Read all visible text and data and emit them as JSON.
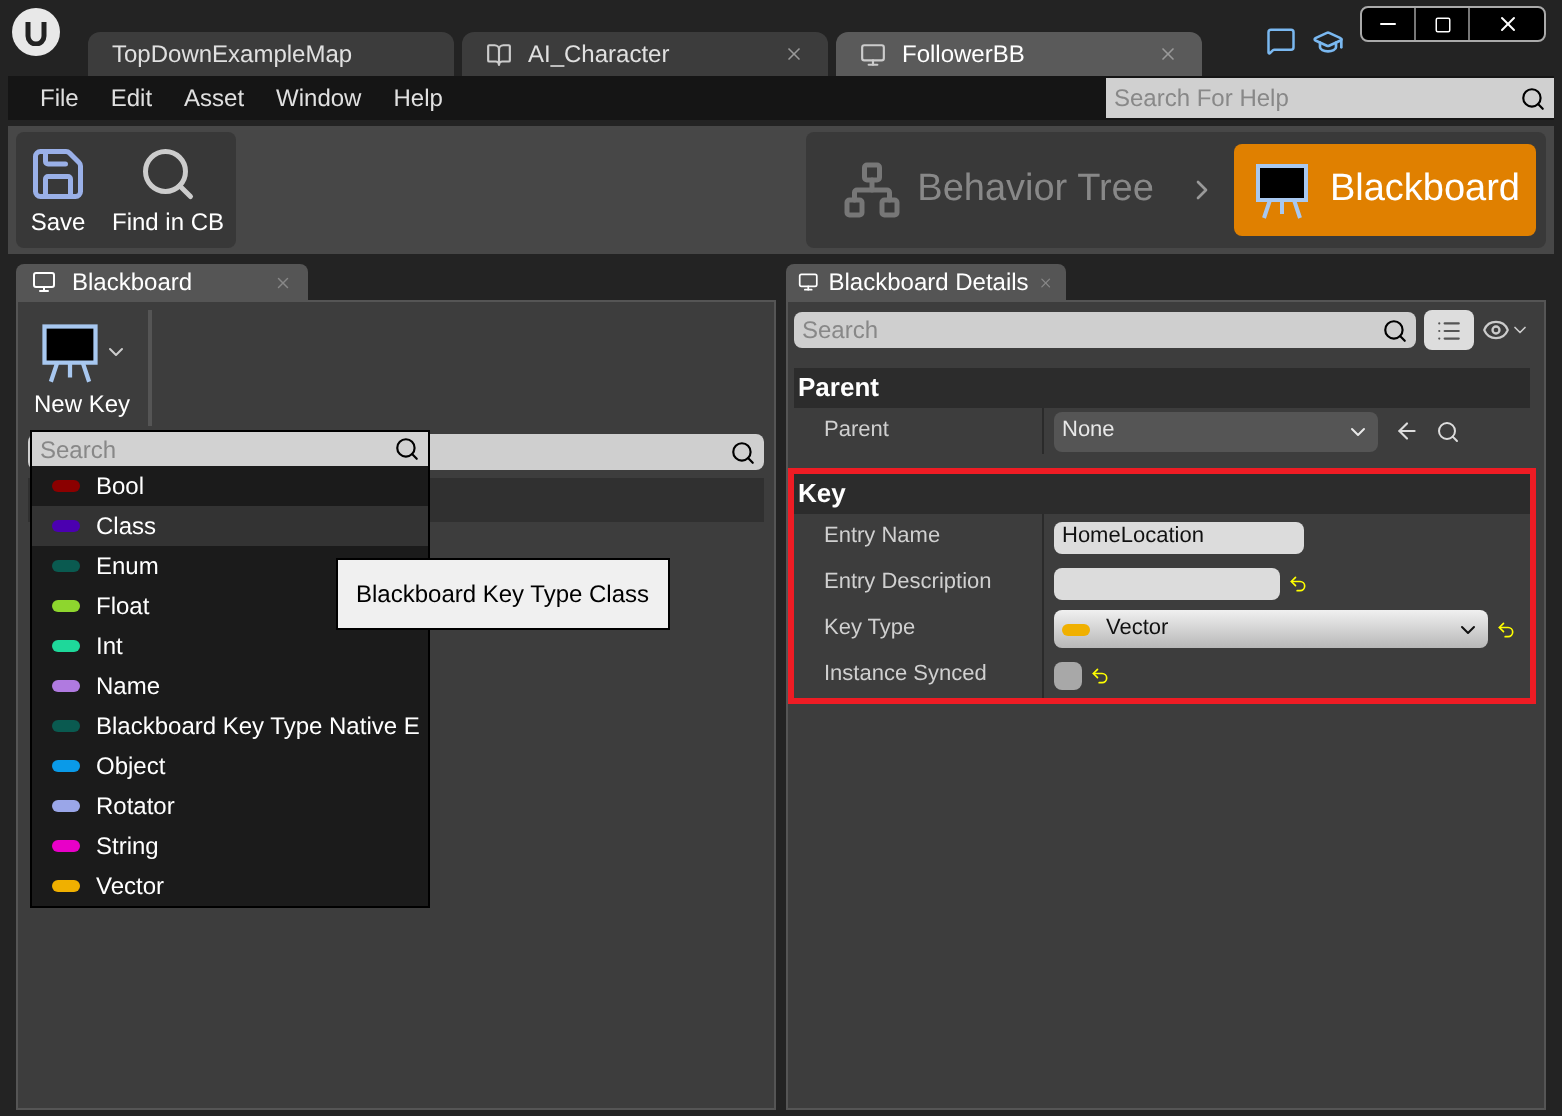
{
  "tabs": [
    {
      "label": "TopDownExampleMap",
      "selected": false,
      "closable": false,
      "kind": "map"
    },
    {
      "label": "AI_Character",
      "selected": false,
      "closable": true,
      "kind": "blueprint"
    },
    {
      "label": "FollowerBB",
      "selected": true,
      "closable": true,
      "kind": "blackboard"
    }
  ],
  "menu": [
    "File",
    "Edit",
    "Asset",
    "Window",
    "Help"
  ],
  "help_search": {
    "placeholder": "Search For Help"
  },
  "toolbar": [
    {
      "label": "Save",
      "kind": "save"
    },
    {
      "label": "Find in CB",
      "kind": "find"
    }
  ],
  "modes": [
    {
      "label": "Behavior Tree",
      "selected": false
    },
    {
      "label": "Blackboard",
      "selected": true
    }
  ],
  "left_panel": {
    "tab": "Blackboard",
    "new_key": "New Key",
    "dropdown": {
      "placeholder": "Search",
      "items": [
        {
          "label": "Bool",
          "color": "#8b0000",
          "selected": false
        },
        {
          "label": "Class",
          "color": "#4b00b0",
          "selected": true
        },
        {
          "label": "Enum",
          "color": "#0a5a50",
          "selected": false
        },
        {
          "label": "Float",
          "color": "#8ed62e",
          "selected": false
        },
        {
          "label": "Int",
          "color": "#1ed89a",
          "selected": false
        },
        {
          "label": "Name",
          "color": "#b07ae0",
          "selected": false
        },
        {
          "label": "Blackboard Key Type Native E",
          "color": "#0a5a50",
          "selected": false
        },
        {
          "label": "Object",
          "color": "#0a9ae8",
          "selected": false
        },
        {
          "label": "Rotator",
          "color": "#9aa6e8",
          "selected": false
        },
        {
          "label": "String",
          "color": "#e800c8",
          "selected": false
        },
        {
          "label": "Vector",
          "color": "#f0b000",
          "selected": false
        }
      ]
    },
    "tooltip": "Blackboard Key Type Class"
  },
  "right_panel": {
    "tab": "Blackboard Details",
    "search": {
      "placeholder": "Search"
    },
    "sections": [
      {
        "title": "Parent",
        "highlighted": false,
        "rows": [
          {
            "label": "Parent",
            "kind": "combo",
            "value": "None",
            "reset": false
          }
        ]
      },
      {
        "title": "Key",
        "highlighted": true,
        "rows": [
          {
            "label": "Entry Name",
            "kind": "text",
            "value": "HomeLocation",
            "reset": false
          },
          {
            "label": "Entry Description",
            "kind": "text",
            "value": "",
            "reset": true
          },
          {
            "label": "Key Type",
            "kind": "dropdown",
            "value": "Vector",
            "color": "#f0b000",
            "reset": true
          },
          {
            "label": "Instance Synced",
            "kind": "checkbox",
            "checked": false,
            "reset": true
          }
        ]
      }
    ]
  }
}
